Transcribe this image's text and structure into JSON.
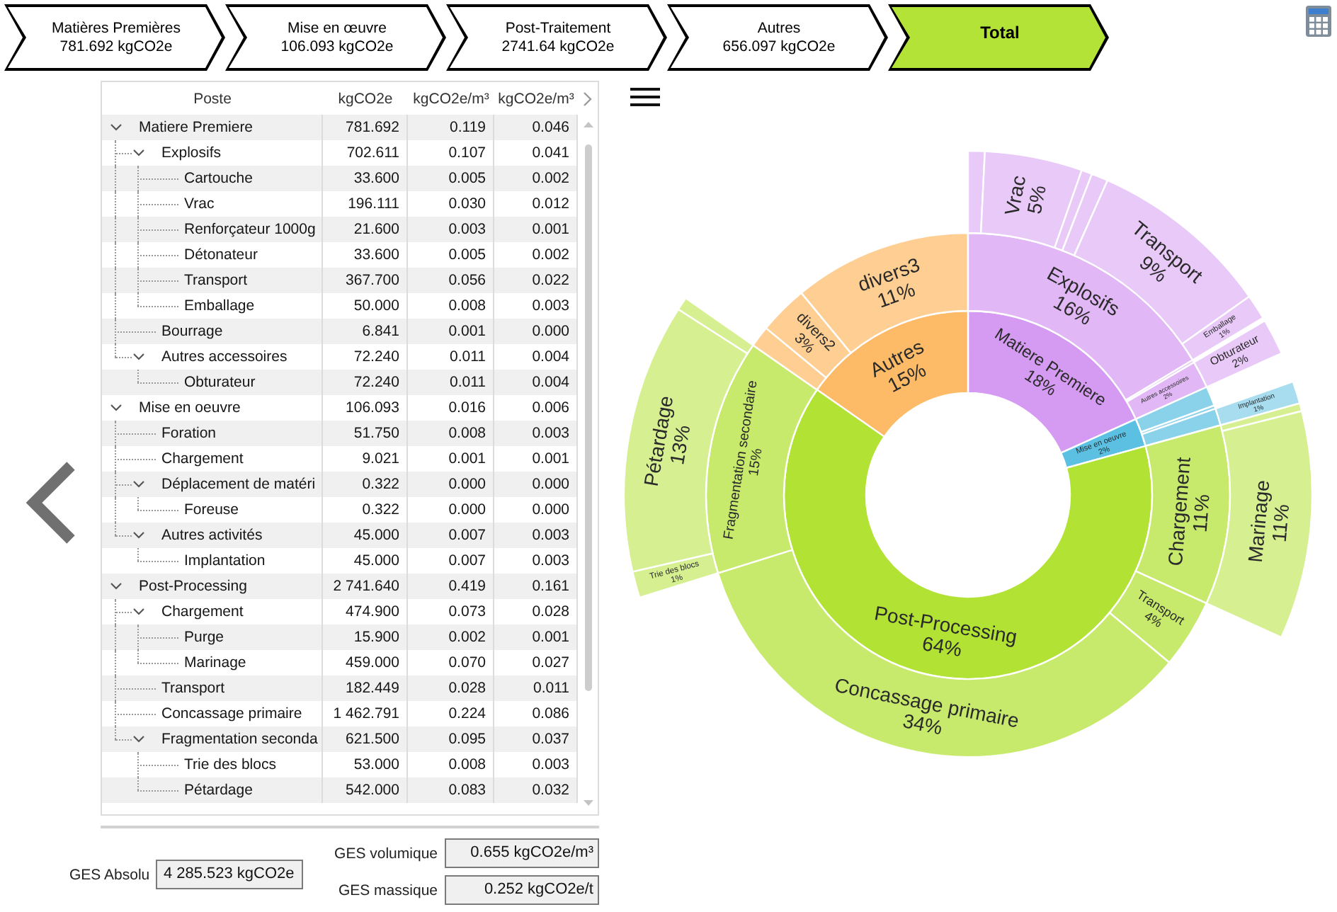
{
  "steps": [
    {
      "label": "Matières Premières",
      "value": "781.692 kgCO2e",
      "selected": false
    },
    {
      "label": "Mise en œuvre",
      "value": "106.093 kgCO2e",
      "selected": false
    },
    {
      "label": "Post-Traitement",
      "value": "2741.64 kgCO2e",
      "selected": false
    },
    {
      "label": "Autres",
      "value": "656.097 kgCO2e",
      "selected": false
    },
    {
      "label": "Total",
      "selected": true
    }
  ],
  "table": {
    "columns": [
      "Poste",
      "kgCO2e",
      "kgCO2e/m³",
      "kgCO2e/m³"
    ],
    "rows": [
      {
        "cells": [
          "Matiere Premiere",
          "781.692",
          "0.119",
          "0.046"
        ],
        "expanded": true,
        "children": [
          {
            "cells": [
              "Explosifs",
              "702.611",
              "0.107",
              "0.041"
            ],
            "expanded": true,
            "children": [
              {
                "cells": [
                  "Cartouche",
                  "33.600",
                  "0.005",
                  "0.002"
                ]
              },
              {
                "cells": [
                  "Vrac",
                  "196.111",
                  "0.030",
                  "0.012"
                ]
              },
              {
                "cells": [
                  "Renforçateur 1000g",
                  "21.600",
                  "0.003",
                  "0.001"
                ]
              },
              {
                "cells": [
                  "Détonateur",
                  "33.600",
                  "0.005",
                  "0.002"
                ]
              },
              {
                "cells": [
                  "Transport",
                  "367.700",
                  "0.056",
                  "0.022"
                ]
              },
              {
                "cells": [
                  "Emballage",
                  "50.000",
                  "0.008",
                  "0.003"
                ]
              }
            ]
          },
          {
            "cells": [
              "Bourrage",
              "6.841",
              "0.001",
              "0.000"
            ]
          },
          {
            "cells": [
              "Autres accessoires",
              "72.240",
              "0.011",
              "0.004"
            ],
            "expanded": true,
            "children": [
              {
                "cells": [
                  "Obturateur",
                  "72.240",
                  "0.011",
                  "0.004"
                ]
              }
            ]
          }
        ]
      },
      {
        "cells": [
          "Mise en oeuvre",
          "106.093",
          "0.016",
          "0.006"
        ],
        "expanded": true,
        "children": [
          {
            "cells": [
              "Foration",
              "51.750",
              "0.008",
              "0.003"
            ]
          },
          {
            "cells": [
              "Chargement",
              "9.021",
              "0.001",
              "0.001"
            ]
          },
          {
            "cells": [
              "Déplacement de matéri",
              "0.322",
              "0.000",
              "0.000"
            ],
            "expanded": true,
            "children": [
              {
                "cells": [
                  "Foreuse",
                  "0.322",
                  "0.000",
                  "0.000"
                ]
              }
            ]
          },
          {
            "cells": [
              "Autres activités",
              "45.000",
              "0.007",
              "0.003"
            ],
            "expanded": true,
            "children": [
              {
                "cells": [
                  "Implantation",
                  "45.000",
                  "0.007",
                  "0.003"
                ]
              }
            ]
          }
        ]
      },
      {
        "cells": [
          "Post-Processing",
          "2 741.640",
          "0.419",
          "0.161"
        ],
        "expanded": true,
        "children": [
          {
            "cells": [
              "Chargement",
              "474.900",
              "0.073",
              "0.028"
            ],
            "expanded": true,
            "children": [
              {
                "cells": [
                  "Purge",
                  "15.900",
                  "0.002",
                  "0.001"
                ]
              },
              {
                "cells": [
                  "Marinage",
                  "459.000",
                  "0.070",
                  "0.027"
                ]
              }
            ]
          },
          {
            "cells": [
              "Transport",
              "182.449",
              "0.028",
              "0.011"
            ]
          },
          {
            "cells": [
              "Concassage primaire",
              "1 462.791",
              "0.224",
              "0.086"
            ]
          },
          {
            "cells": [
              "Fragmentation seconda",
              "621.500",
              "0.095",
              "0.037"
            ],
            "expanded": true,
            "children": [
              {
                "cells": [
                  "Trie des blocs",
                  "53.000",
                  "0.008",
                  "0.003"
                ]
              },
              {
                "cells": [
                  "Pétardage",
                  "542.000",
                  "0.083",
                  "0.032"
                ]
              }
            ]
          }
        ]
      }
    ]
  },
  "summary": [
    {
      "label": "GES Absolu",
      "value": "4 285.523 kgCO2e"
    },
    {
      "label": "GES volumique",
      "value": "0.655 kgCO2e/m³"
    },
    {
      "label": "GES massique",
      "value": "0.252 kgCO2e/t"
    }
  ],
  "sunburst": {
    "rings": [
      {
        "chart_data": {
          "type": "donut",
          "categories": [
            "Matiere Premiere",
            "Mise en oeuvre",
            "Post-Processing",
            "Autres"
          ],
          "values": [
            18.24,
            2.48,
            63.97,
            15.31
          ],
          "data_labels": true,
          "value_labels": [
            "18%",
            "2%",
            "64%",
            "15%"
          ]
        }
      },
      {
        "chart_data": {
          "type": "donut",
          "categories": [
            "Explosifs",
            null,
            "Autres accessoires",
            null,
            null,
            null,
            "Chargement",
            "Transport",
            "Concassage primaire",
            "Fragmentation secondaire",
            null,
            "divers2",
            "divers3"
          ],
          "values": [
            16.39,
            0.16,
            1.69,
            1.21,
            0.21,
            1.05,
            11.08,
            4.26,
            34.13,
            14.5,
            1.31,
            3.03,
            10.97
          ],
          "data_labels": true,
          "value_labels": [
            "16%",
            null,
            "2%",
            null,
            null,
            null,
            "11%",
            "4%",
            "34%",
            "15%",
            null,
            "3%",
            "11%"
          ]
        }
      }
    ],
    "outer_ring_labels": [
      {
        "label": "Vrac",
        "percent": "5%"
      },
      {
        "label": "Transport",
        "percent": "9%"
      },
      {
        "label": "Emballage",
        "percent": "1%"
      },
      {
        "label": "Obturateur",
        "percent": "2%"
      },
      {
        "label": "Implantation",
        "percent": "1%"
      },
      {
        "label": "Marinage",
        "percent": "11%"
      },
      {
        "label": "Trie des blocs",
        "percent": "1%"
      },
      {
        "label": "Pétardage",
        "percent": "13%"
      }
    ]
  }
}
